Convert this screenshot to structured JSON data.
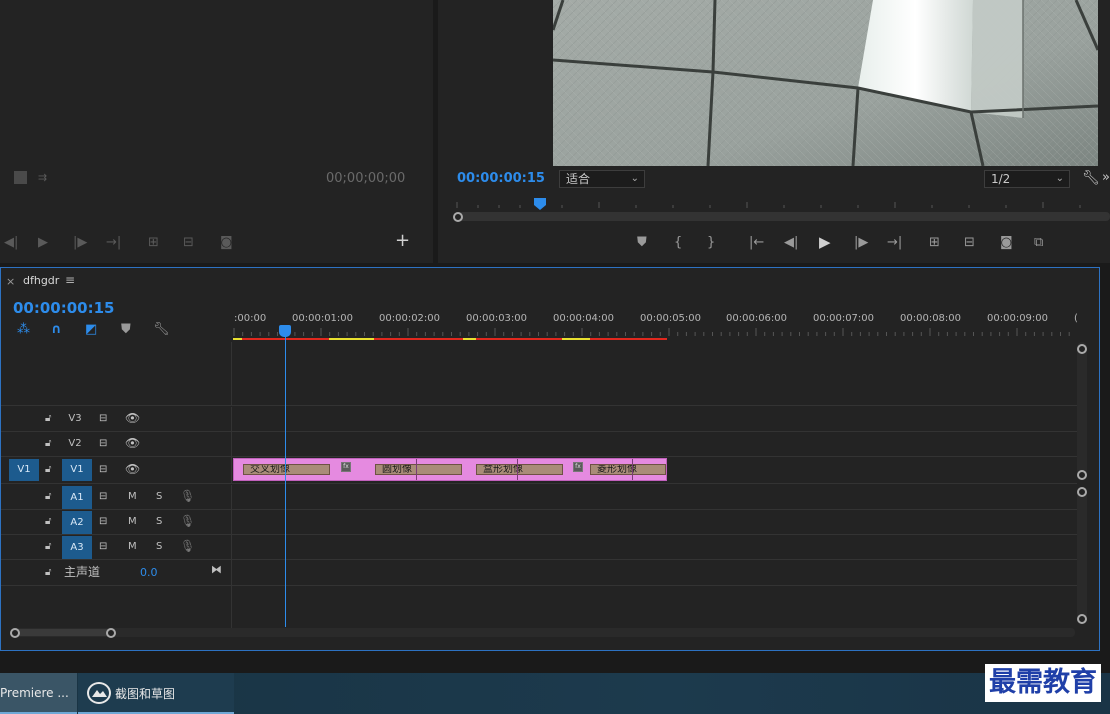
{
  "source_monitor": {
    "timecode": "00;00;00;00"
  },
  "program_monitor": {
    "timecode": "00:00:00:15",
    "fit_select": "适合",
    "resolution_select": "1/2"
  },
  "timeline": {
    "sequence_name": "dfhgdr",
    "close_label": "×",
    "menu_label": "≡",
    "timecode": "00:00:00:15",
    "ruler": [
      ":00:00",
      "00:00:01:00",
      "00:00:02:00",
      "00:00:03:00",
      "00:00:04:00",
      "00:00:05:00",
      "00:00:06:00",
      "00:00:07:00",
      "00:00:08:00",
      "00:00:09:00",
      "("
    ],
    "video_tracks": [
      {
        "id": "V3",
        "source": ""
      },
      {
        "id": "V2",
        "source": ""
      },
      {
        "id": "V1",
        "source": "V1"
      }
    ],
    "audio_tracks": [
      {
        "id": "A1",
        "m": "M",
        "s": "S"
      },
      {
        "id": "A2",
        "m": "M",
        "s": "S"
      },
      {
        "id": "A3",
        "m": "M",
        "s": "S"
      }
    ],
    "master": {
      "label": "主声道",
      "value": "0.0"
    },
    "clips": [
      {
        "label": "交叉划像"
      },
      {
        "label": "圆划像"
      },
      {
        "label": "盒形划像"
      },
      {
        "label": "菱形划像"
      }
    ],
    "fx_label": "fx"
  },
  "taskbar": {
    "items": [
      {
        "label": "Premiere ..."
      },
      {
        "label": "截图和草图"
      }
    ]
  },
  "watermark": "最需教育",
  "colors": {
    "accent": "#2d8ceb",
    "clip_bg": "#e58ae0",
    "render_red": "#e0281e",
    "render_yellow": "#e8e030",
    "track_blue": "#1d5b8e"
  }
}
